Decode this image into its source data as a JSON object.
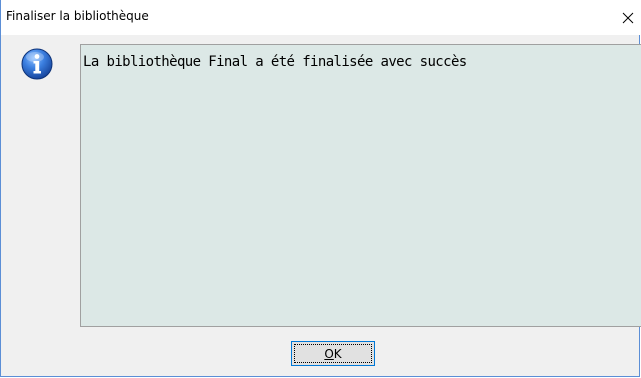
{
  "window": {
    "title": "Finaliser la bibliothèque",
    "close_glyph": "✕"
  },
  "dialog": {
    "icon": "info-icon",
    "message": "La bibliothèque Final a été finalisée avec succès"
  },
  "buttons": {
    "ok_mnemonic": "O",
    "ok_rest": "K"
  },
  "colors": {
    "window_border": "#5b8ed6",
    "message_background": "#dce8e6",
    "info_icon_blue": "#1f5fc8",
    "button_border": "#0078d7"
  }
}
